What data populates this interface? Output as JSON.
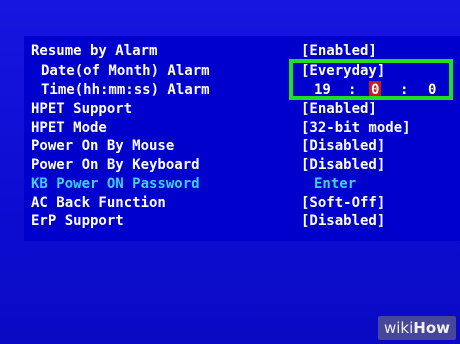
{
  "settings": [
    {
      "label": "Resume by Alarm",
      "value": "[Enabled]"
    },
    {
      "label": "Date(of Month) Alarm",
      "value": "[Everyday]"
    },
    {
      "label": "Time(hh:mm:ss) Alarm",
      "time": {
        "hh": "19",
        "sep1": ":",
        "mm": "0",
        "sep2": ":",
        "ss": "0"
      }
    },
    {
      "label": "HPET Support",
      "value": "[Enabled]"
    },
    {
      "label": "HPET Mode",
      "value": "[32-bit mode]"
    },
    {
      "label": "Power On By Mouse",
      "value": "[Disabled]"
    },
    {
      "label": "Power On By Keyboard",
      "value": "[Disabled]"
    },
    {
      "label": "KB Power ON Password",
      "value": "Enter"
    },
    {
      "label": "AC Back Function",
      "value": "[Soft-Off]"
    },
    {
      "label": "ErP Support",
      "value": "[Disabled]"
    }
  ],
  "watermark": {
    "part1": "wiki",
    "part2": "How"
  },
  "colors": {
    "background": "#0000cc",
    "text": "#ffffff",
    "highlight_text": "#3fd0ff",
    "selected_field": "#cc1b1b",
    "annotation_box": "#1ee01e"
  }
}
